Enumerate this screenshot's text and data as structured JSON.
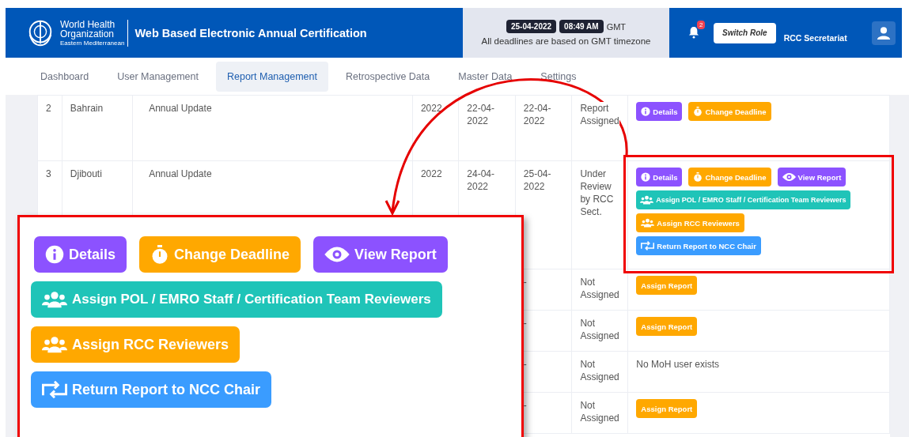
{
  "header": {
    "org_name_line_1": "World Health",
    "org_name_line_2": "Organization",
    "org_region": "Eastern Mediterranean",
    "app_title": "Web Based Electronic Annual Certification",
    "date": "25-04-2022",
    "time": "08:49 AM",
    "timezone": "GMT",
    "deadline_note": "All deadlines are based on GMT timezone",
    "notification_count": "2",
    "switch_role": "Switch Role",
    "role": "RCC Secretariat"
  },
  "nav_tabs": [
    {
      "label": "Dashboard",
      "selected": false
    },
    {
      "label": "User Management",
      "selected": false
    },
    {
      "label": "Report Management",
      "selected": true
    },
    {
      "label": "Retrospective Data",
      "selected": false
    },
    {
      "label": "Master Data",
      "selected": false
    },
    {
      "label": "Settings",
      "selected": false
    }
  ],
  "table": {
    "rows": [
      {
        "number": "2",
        "country": "Bahrain",
        "type": "Annual Update",
        "year": "2022",
        "start": "22-04-2022",
        "end": "22-04-2022",
        "status": "Report Assigned",
        "actions": [
          [
            {
              "kind": "details",
              "label": "Details"
            },
            {
              "kind": "change-deadline",
              "label": "Change Deadline"
            }
          ]
        ]
      },
      {
        "number": "3",
        "country": "Djibouti",
        "type": "Annual Update",
        "year": "2022",
        "start": "24-04-2022",
        "end": "25-04-2022",
        "status": "Under Review by RCC Sect.",
        "actions": [
          [
            {
              "kind": "details",
              "label": "Details"
            },
            {
              "kind": "change-deadline",
              "label": "Change Deadline"
            },
            {
              "kind": "view-report",
              "label": "View Report"
            }
          ],
          [
            {
              "kind": "assign-team",
              "label": "Assign POL / EMRO Staff / Certification Team Reviewers"
            }
          ],
          [
            {
              "kind": "assign-rcc",
              "label": "Assign RCC Reviewers"
            }
          ],
          [
            {
              "kind": "return",
              "label": "Return Report to NCC Chair"
            }
          ]
        ]
      },
      {
        "end": "-",
        "status": "Not Assigned",
        "actions": [
          [
            {
              "kind": "assign-report",
              "label": "Assign Report"
            }
          ]
        ]
      },
      {
        "end": "-",
        "status": "Not Assigned",
        "actions": [
          [
            {
              "kind": "assign-report",
              "label": "Assign Report"
            }
          ]
        ]
      },
      {
        "end": "-",
        "status": "Not Assigned",
        "note": "No MoH user exists"
      },
      {
        "end": "-",
        "status": "Not Assigned",
        "actions": [
          [
            {
              "kind": "assign-report",
              "label": "Assign Report"
            }
          ]
        ]
      }
    ]
  },
  "callout": {
    "buttons": [
      [
        {
          "kind": "details",
          "label": "Details"
        },
        {
          "kind": "change-deadline",
          "label": "Change Deadline"
        },
        {
          "kind": "view-report",
          "label": "View Report"
        }
      ],
      [
        {
          "kind": "assign-team",
          "label": "Assign POL / EMRO Staff / Certification Team Reviewers"
        }
      ],
      [
        {
          "kind": "assign-rcc",
          "label": "Assign RCC Reviewers"
        }
      ],
      [
        {
          "kind": "return",
          "label": "Return Report to NCC Chair"
        }
      ]
    ]
  }
}
